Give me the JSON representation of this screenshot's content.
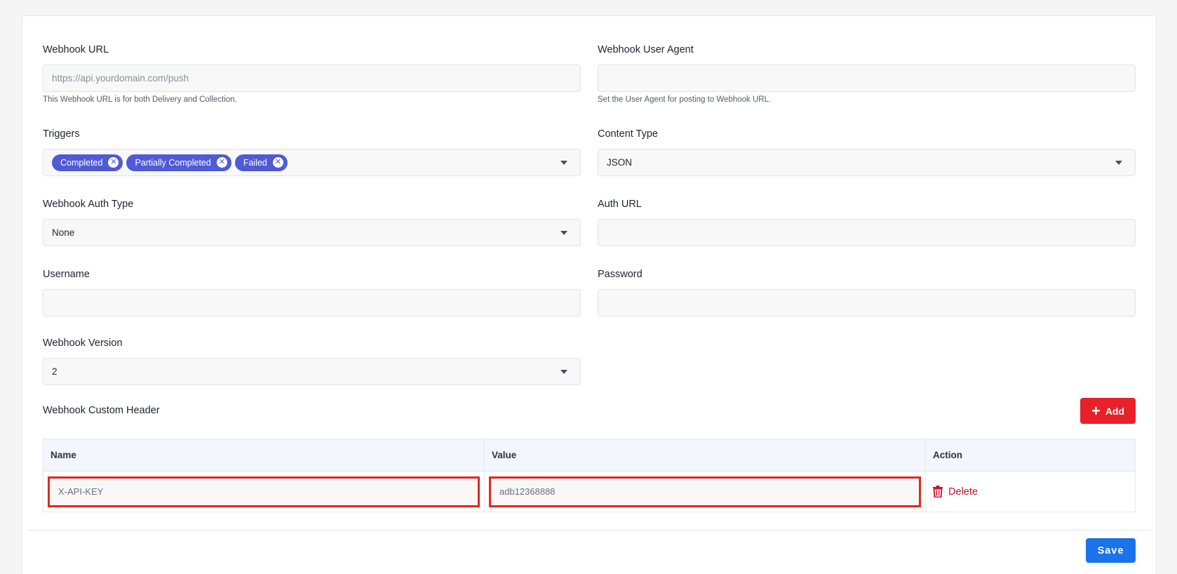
{
  "form": {
    "webhook_url": {
      "label": "Webhook URL",
      "placeholder": "https://api.yourdomain.com/push",
      "help": "This Webhook URL is for both Delivery and Collection."
    },
    "user_agent": {
      "label": "Webhook User Agent",
      "value": "",
      "help": "Set the User Agent for posting to Webhook URL."
    },
    "triggers": {
      "label": "Triggers",
      "chips": [
        "Completed",
        "Partially Completed",
        "Failed"
      ]
    },
    "content_type": {
      "label": "Content Type",
      "value": "JSON"
    },
    "auth_type": {
      "label": "Webhook Auth Type",
      "value": "None"
    },
    "auth_url": {
      "label": "Auth URL",
      "value": ""
    },
    "username": {
      "label": "Username",
      "value": ""
    },
    "password": {
      "label": "Password",
      "value": ""
    },
    "version": {
      "label": "Webhook Version",
      "value": "2"
    }
  },
  "custom_header": {
    "title": "Webhook Custom Header",
    "add_label": "Add",
    "columns": [
      "Name",
      "Value",
      "Action"
    ],
    "rows": [
      {
        "name": "X-API-KEY",
        "value": "adb12368888",
        "action": "Delete"
      }
    ]
  },
  "footer": {
    "save_label": "Save"
  },
  "colors": {
    "chip": "#4f5bd5",
    "add_button": "#e8202a",
    "save_button": "#1a73e8",
    "delete_text": "#c8102e",
    "highlight_border": "#e3281c"
  }
}
